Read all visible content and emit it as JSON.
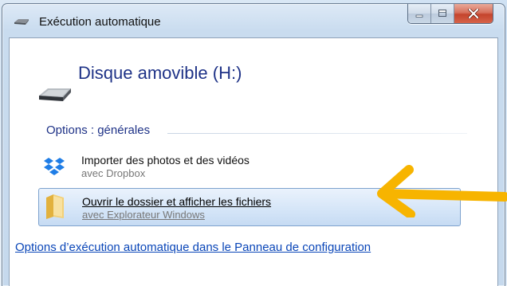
{
  "window": {
    "title": "Exécution automatique",
    "controls": [
      "minimize-button",
      "maximize-button",
      "close-button"
    ]
  },
  "device": {
    "title": "Disque amovible (H:)",
    "icon": "removable-drive-icon"
  },
  "section": {
    "header": "Options : générales"
  },
  "options": [
    {
      "title": "Importer des photos et des vidéos",
      "subtitle": "avec Dropbox",
      "icon": "dropbox-icon",
      "selected": false
    },
    {
      "title": "Ouvrir le dossier et afficher les fichiers",
      "subtitle": "avec Explorateur Windows",
      "icon": "folder-icon",
      "selected": true
    }
  ],
  "footer": {
    "link": "Options d’exécution automatique dans le Panneau de configuration"
  },
  "annotation": {
    "arrow_color": "#f7b400"
  }
}
